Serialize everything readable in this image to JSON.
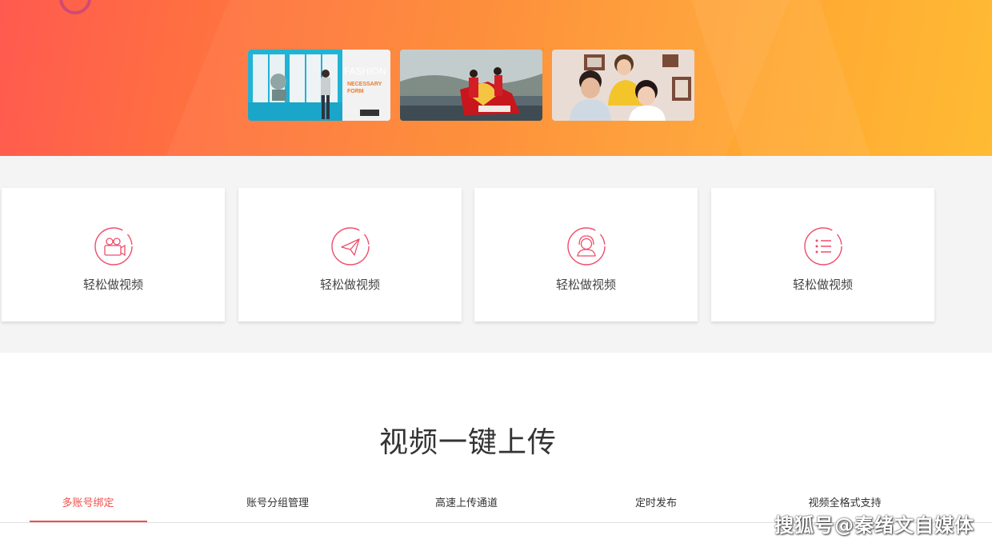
{
  "feature_cards": [
    {
      "label": "轻松做视频",
      "icon": "video-camera-icon"
    },
    {
      "label": "轻松做视频",
      "icon": "paper-plane-icon"
    },
    {
      "label": "轻松做视频",
      "icon": "user-headset-icon"
    },
    {
      "label": "轻松做视频",
      "icon": "list-icon"
    }
  ],
  "section": {
    "title": "视频一键上传",
    "tabs": [
      {
        "label": "多账号绑定",
        "active": true
      },
      {
        "label": "账号分组管理",
        "active": false
      },
      {
        "label": "高速上传通道",
        "active": false
      },
      {
        "label": "定时发布",
        "active": false
      },
      {
        "label": "视频全格式支持",
        "active": false
      }
    ]
  },
  "thumbnails": [
    {
      "text_1": "FASHION",
      "text_2": "NECESSARY",
      "text_3": "FORM"
    }
  ],
  "watermark": "搜狐号@秦绪文自媒体",
  "colors": {
    "accent": "#f1504b",
    "hero_start": "#ff5a4f",
    "hero_end": "#ffbb33",
    "card_bg": "#ffffff",
    "band_bg": "#f4f4f4"
  }
}
